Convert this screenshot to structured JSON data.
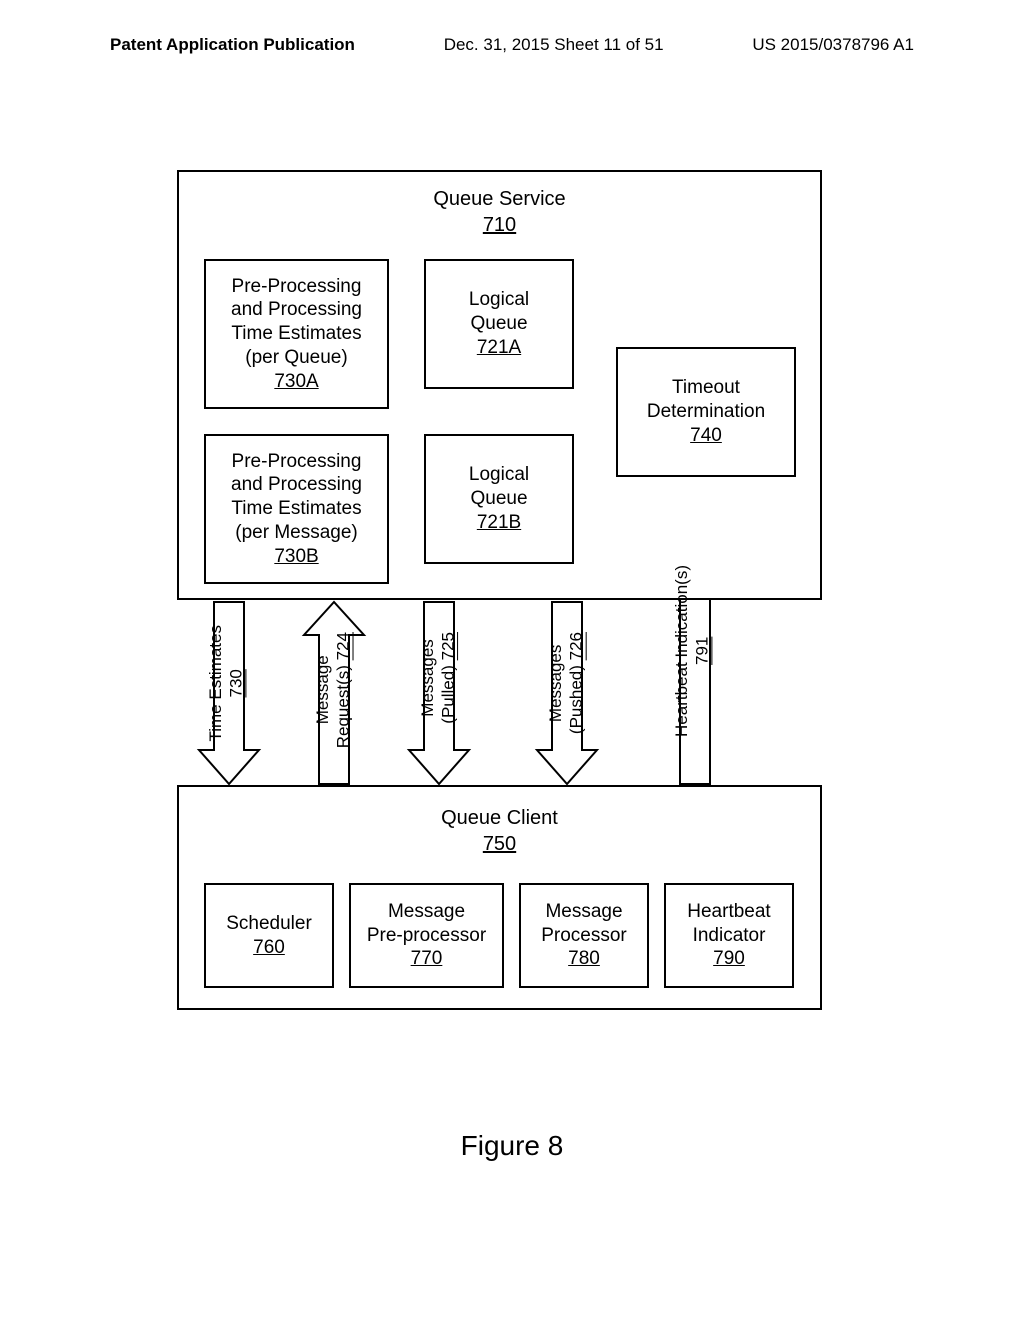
{
  "header": {
    "left": "Patent Application Publication",
    "center": "Dec. 31, 2015  Sheet 11 of 51",
    "right": "US 2015/0378796 A1"
  },
  "queue_service": {
    "title": "Queue Service",
    "ref": "710"
  },
  "estimates_a": {
    "line1": "Pre-Processing",
    "line2": "and Processing",
    "line3": "Time Estimates",
    "line4": "(per Queue)",
    "ref": "730A"
  },
  "estimates_b": {
    "line1": "Pre-Processing",
    "line2": "and Processing",
    "line3": "Time Estimates",
    "line4": "(per Message)",
    "ref": "730B"
  },
  "logical_a": {
    "line1": "Logical",
    "line2": "Queue",
    "ref": "721A"
  },
  "logical_b": {
    "line1": "Logical",
    "line2": "Queue",
    "ref": "721B"
  },
  "timeout": {
    "line1": "Timeout",
    "line2": "Determination",
    "ref": "740"
  },
  "queue_client": {
    "title": "Queue Client",
    "ref": "750"
  },
  "scheduler": {
    "title": "Scheduler",
    "ref": "760"
  },
  "preprocessor": {
    "line1": "Message",
    "line2": "Pre-processor",
    "ref": "770"
  },
  "processor": {
    "line1": "Message",
    "line2": "Processor",
    "ref": "780"
  },
  "heartbeat_ind": {
    "line1": "Heartbeat",
    "line2": "Indicator",
    "ref": "790"
  },
  "arrows": {
    "time_estimates": {
      "label": "Time Estimates",
      "ref": "730"
    },
    "message_requests": {
      "label": "Message",
      "label2": "Request(s)",
      "ref": "724"
    },
    "messages_pulled": {
      "label": "Messages",
      "label2": "(Pulled)",
      "ref": "725"
    },
    "messages_pushed": {
      "label": "Messages",
      "label2": "(Pushed)",
      "ref": "726"
    },
    "heartbeat": {
      "label": "Heartbeat Indication(s)",
      "ref": "791"
    }
  },
  "figure_label": "Figure 8"
}
